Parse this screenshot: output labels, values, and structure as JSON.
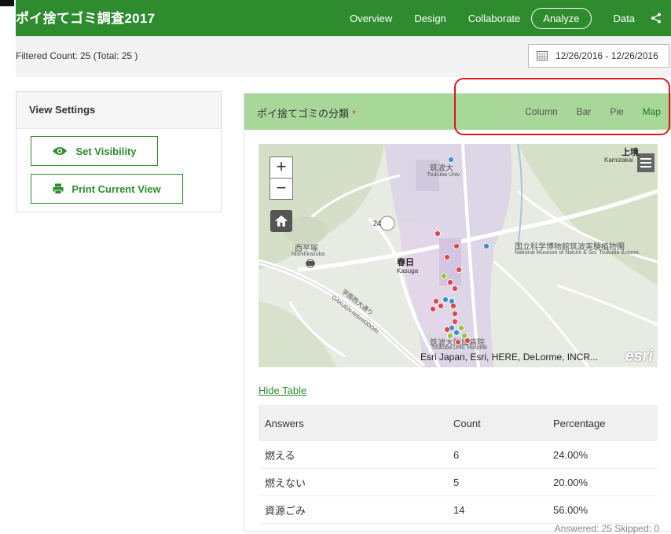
{
  "app": {
    "title": "ポイ捨てゴミ調査2017"
  },
  "nav": {
    "items": [
      "Overview",
      "Design",
      "Collaborate",
      "Analyze",
      "Data"
    ],
    "active": "Analyze"
  },
  "filter": {
    "count_text": "Filtered Count: 25 (Total: 25 )",
    "date_range": "12/26/2016 - 12/26/2016"
  },
  "view_settings": {
    "header": "View Settings",
    "set_visibility": "Set Visibility",
    "print_view": "Print Current View"
  },
  "card": {
    "title": "ポイ捨てゴミの分類",
    "required_mark": "*",
    "tabs": [
      "Column",
      "Bar",
      "Pie",
      "Map"
    ],
    "active_tab": "Map"
  },
  "map": {
    "labels": {
      "tsukuba_univ": "筑波大",
      "tsukuba_univ_en": "Tsukuba Univ.",
      "kamigo": "上境",
      "kamigo_en": "Kamizakai",
      "nishihirazuka": "西平塚",
      "nishihirazuka_en": "Nishihirazuka",
      "kasuga": "春日",
      "kasuga_en": "Kasuga",
      "museum": "国立科学博物館筑波実験植物園",
      "museum_en": "National Museum of Nature & Sci. Tsukuba Botanic",
      "hospital": "筑波大附属病院",
      "hospital_en": "Tsukuba Univ. Hospital",
      "road": "学園西大通り",
      "road_en": "GAKUEN-NISHIODORI",
      "route": "24"
    },
    "attribution": "Esri Japan, Esri, HERE, DeLorme, INCR...",
    "logo": "esri",
    "zoom_in": "+",
    "zoom_out": "−"
  },
  "table": {
    "hide_label": "Hide Table",
    "headers": [
      "Answers",
      "Count",
      "Percentage"
    ],
    "rows": [
      [
        "燃える",
        "6",
        "24.00%"
      ],
      [
        "燃えない",
        "5",
        "20.00%"
      ],
      [
        "資源ごみ",
        "14",
        "56.00%"
      ]
    ],
    "footer": "Answered: 25  Skipped: 0"
  },
  "colors": {
    "brand": "#2e8b2e",
    "header_green": "#a8d79a",
    "highlight": "#e0161c",
    "burnable": "#d9474f",
    "nonburnable": "#9dc23b",
    "recyclable": "#3d8fc9"
  }
}
